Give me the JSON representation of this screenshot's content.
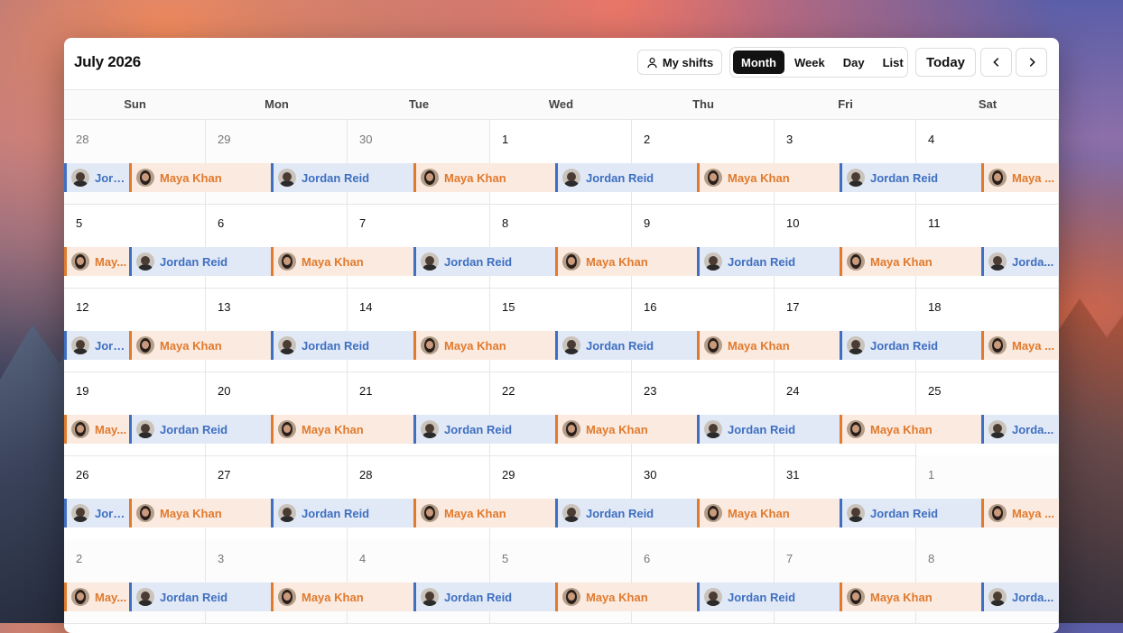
{
  "header": {
    "title": "July 2026",
    "my_shifts_label": "My shifts",
    "views": [
      "Month",
      "Week",
      "Day",
      "List"
    ],
    "active_view": "Month",
    "today_label": "Today"
  },
  "weekdays": [
    "Sun",
    "Mon",
    "Tue",
    "Wed",
    "Thu",
    "Fri",
    "Sat"
  ],
  "people": {
    "J": {
      "name": "Jordan Reid",
      "color": "#3e6fc1"
    },
    "M": {
      "name": "Maya Khan",
      "color": "#e07a2e"
    }
  },
  "weeks": [
    {
      "days": [
        {
          "n": "28",
          "out": true
        },
        {
          "n": "29",
          "out": true
        },
        {
          "n": "30",
          "out": true
        },
        {
          "n": "1"
        },
        {
          "n": "2"
        },
        {
          "n": "3"
        },
        {
          "n": "4"
        }
      ],
      "events": [
        [
          "J",
          "Jord..."
        ],
        [
          "M",
          "Maya Khan"
        ],
        [
          "J",
          "Jordan Reid"
        ],
        [
          "M",
          "Maya Khan"
        ],
        [
          "J",
          "Jordan Reid"
        ],
        [
          "M",
          "Maya Khan"
        ],
        [
          "J",
          "Jordan Reid"
        ],
        [
          "M",
          "Maya ..."
        ]
      ]
    },
    {
      "days": [
        {
          "n": "5"
        },
        {
          "n": "6"
        },
        {
          "n": "7"
        },
        {
          "n": "8"
        },
        {
          "n": "9"
        },
        {
          "n": "10"
        },
        {
          "n": "11"
        }
      ],
      "events": [
        [
          "M",
          "May..."
        ],
        [
          "J",
          "Jordan Reid"
        ],
        [
          "M",
          "Maya Khan"
        ],
        [
          "J",
          "Jordan Reid"
        ],
        [
          "M",
          "Maya Khan"
        ],
        [
          "J",
          "Jordan Reid"
        ],
        [
          "M",
          "Maya Khan"
        ],
        [
          "J",
          "Jorda..."
        ]
      ]
    },
    {
      "days": [
        {
          "n": "12"
        },
        {
          "n": "13"
        },
        {
          "n": "14"
        },
        {
          "n": "15"
        },
        {
          "n": "16"
        },
        {
          "n": "17"
        },
        {
          "n": "18"
        }
      ],
      "events": [
        [
          "J",
          "Jord..."
        ],
        [
          "M",
          "Maya Khan"
        ],
        [
          "J",
          "Jordan Reid"
        ],
        [
          "M",
          "Maya Khan"
        ],
        [
          "J",
          "Jordan Reid"
        ],
        [
          "M",
          "Maya Khan"
        ],
        [
          "J",
          "Jordan Reid"
        ],
        [
          "M",
          "Maya ..."
        ]
      ]
    },
    {
      "days": [
        {
          "n": "19"
        },
        {
          "n": "20"
        },
        {
          "n": "21"
        },
        {
          "n": "22"
        },
        {
          "n": "23"
        },
        {
          "n": "24"
        },
        {
          "n": "25"
        }
      ],
      "events": [
        [
          "M",
          "May..."
        ],
        [
          "J",
          "Jordan Reid"
        ],
        [
          "M",
          "Maya Khan"
        ],
        [
          "J",
          "Jordan Reid"
        ],
        [
          "M",
          "Maya Khan"
        ],
        [
          "J",
          "Jordan Reid"
        ],
        [
          "M",
          "Maya Khan"
        ],
        [
          "J",
          "Jorda..."
        ]
      ]
    },
    {
      "days": [
        {
          "n": "26"
        },
        {
          "n": "27"
        },
        {
          "n": "28"
        },
        {
          "n": "29"
        },
        {
          "n": "30"
        },
        {
          "n": "31"
        },
        {
          "n": "1",
          "out": true
        }
      ],
      "events": [
        [
          "J",
          "Jord..."
        ],
        [
          "M",
          "Maya Khan"
        ],
        [
          "J",
          "Jordan Reid"
        ],
        [
          "M",
          "Maya Khan"
        ],
        [
          "J",
          "Jordan Reid"
        ],
        [
          "M",
          "Maya Khan"
        ],
        [
          "J",
          "Jordan Reid"
        ],
        [
          "M",
          "Maya ..."
        ]
      ]
    },
    {
      "days": [
        {
          "n": "2",
          "out": true
        },
        {
          "n": "3",
          "out": true
        },
        {
          "n": "4",
          "out": true
        },
        {
          "n": "5",
          "out": true
        },
        {
          "n": "6",
          "out": true
        },
        {
          "n": "7",
          "out": true
        },
        {
          "n": "8",
          "out": true
        }
      ],
      "events": [
        [
          "M",
          "May..."
        ],
        [
          "J",
          "Jordan Reid"
        ],
        [
          "M",
          "Maya Khan"
        ],
        [
          "J",
          "Jordan Reid"
        ],
        [
          "M",
          "Maya Khan"
        ],
        [
          "J",
          "Jordan Reid"
        ],
        [
          "M",
          "Maya Khan"
        ],
        [
          "J",
          "Jorda..."
        ]
      ]
    }
  ]
}
